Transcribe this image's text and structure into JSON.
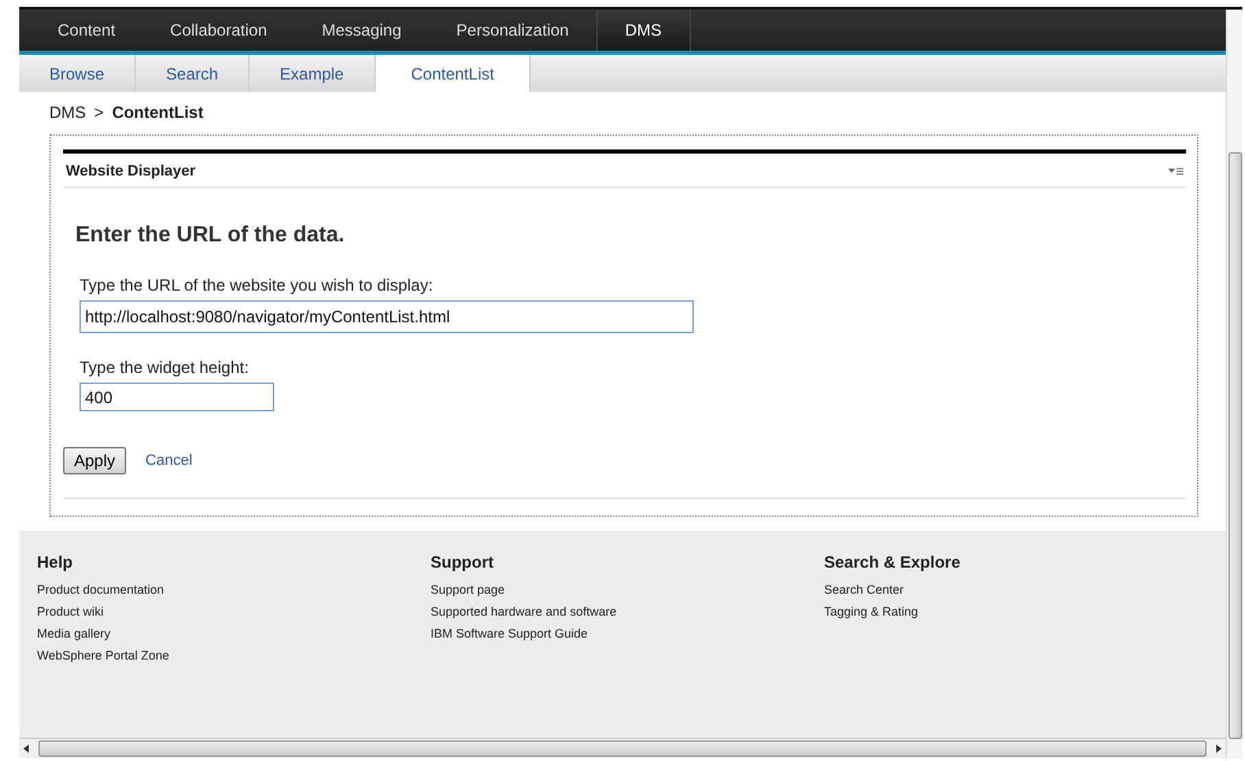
{
  "top_nav": [
    {
      "label": "Content",
      "selected": false
    },
    {
      "label": "Collaboration",
      "selected": false
    },
    {
      "label": "Messaging",
      "selected": false
    },
    {
      "label": "Personalization",
      "selected": false
    },
    {
      "label": "DMS",
      "selected": true
    }
  ],
  "sub_nav": [
    {
      "label": "Browse",
      "selected": false
    },
    {
      "label": "Search",
      "selected": false
    },
    {
      "label": "Example",
      "selected": false
    },
    {
      "label": "ContentList",
      "selected": true
    }
  ],
  "breadcrumb": {
    "parent": "DMS",
    "separator": ">",
    "current": "ContentList"
  },
  "portlet": {
    "title": "Website Displayer",
    "heading": "Enter the URL of the data.",
    "fields": [
      {
        "label": "Type the URL of the website you wish to display:",
        "value": "http://localhost:9080/navigator/myContentList.html",
        "kind": "wide"
      },
      {
        "label": "Type the widget height:",
        "value": "400",
        "kind": "narrow"
      }
    ],
    "apply": "Apply",
    "cancel": "Cancel"
  },
  "footer": [
    {
      "title": "Help",
      "links": [
        "Product documentation",
        "Product wiki",
        "Media gallery",
        "WebSphere Portal Zone"
      ]
    },
    {
      "title": "Support",
      "links": [
        "Support page",
        "Supported hardware and software",
        "IBM Software Support Guide"
      ]
    },
    {
      "title": "Search & Explore",
      "links": [
        "Search Center",
        "Tagging & Rating"
      ]
    }
  ]
}
